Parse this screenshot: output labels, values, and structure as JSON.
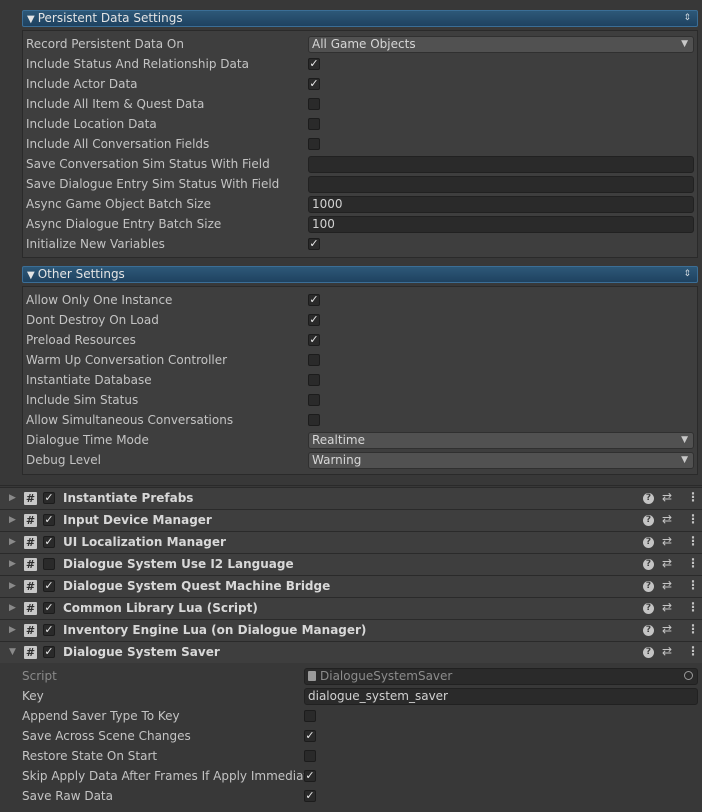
{
  "persistent": {
    "title": "Persistent Data Settings",
    "record_label": "Record Persistent Data On",
    "record_value": "All Game Objects",
    "status_label": "Include Status And Relationship Data",
    "status_checked": true,
    "actor_label": "Include Actor Data",
    "actor_checked": true,
    "items_label": "Include All Item & Quest Data",
    "items_checked": false,
    "location_label": "Include Location Data",
    "location_checked": false,
    "convfields_label": "Include All Conversation Fields",
    "convfields_checked": false,
    "conv_sim_label": "Save Conversation Sim Status With Field",
    "conv_sim_value": "",
    "entry_sim_label": "Save Dialogue Entry Sim Status With Field",
    "entry_sim_value": "",
    "async_go_label": "Async Game Object Batch Size",
    "async_go_value": "1000",
    "async_entry_label": "Async Dialogue Entry Batch Size",
    "async_entry_value": "100",
    "init_vars_label": "Initialize New Variables",
    "init_vars_checked": true
  },
  "other": {
    "title": "Other Settings",
    "one_instance_label": "Allow Only One Instance",
    "one_instance_checked": true,
    "dont_destroy_label": "Dont Destroy On Load",
    "dont_destroy_checked": true,
    "preload_label": "Preload Resources",
    "preload_checked": true,
    "warmup_label": "Warm Up Conversation Controller",
    "warmup_checked": false,
    "instantiate_db_label": "Instantiate Database",
    "instantiate_db_checked": false,
    "sim_status_label": "Include Sim Status",
    "sim_status_checked": false,
    "simultaneous_label": "Allow Simultaneous Conversations",
    "simultaneous_checked": false,
    "time_mode_label": "Dialogue Time Mode",
    "time_mode_value": "Realtime",
    "debug_label": "Debug Level",
    "debug_value": "Warning"
  },
  "components": [
    {
      "name": "Instantiate Prefabs",
      "enabled": true
    },
    {
      "name": "Input Device Manager",
      "enabled": true
    },
    {
      "name": "UI Localization Manager",
      "enabled": true
    },
    {
      "name": "Dialogue System Use I2 Language",
      "enabled": false
    },
    {
      "name": "Dialogue System Quest Machine Bridge",
      "enabled": true
    },
    {
      "name": "Common Library Lua (Script)",
      "enabled": true
    },
    {
      "name": "Inventory Engine Lua (on Dialogue Manager)",
      "enabled": true
    },
    {
      "name": "Dialogue System Saver",
      "enabled": true
    }
  ],
  "saver": {
    "script_label": "Script",
    "script_value": "DialogueSystemSaver",
    "key_label": "Key",
    "key_value": "dialogue_system_saver",
    "append_label": "Append Saver Type To Key",
    "append_checked": false,
    "across_label": "Save Across Scene Changes",
    "across_checked": true,
    "restore_label": "Restore State On Start",
    "restore_checked": false,
    "skip_label": "Skip Apply Data After Frames If Apply Immediate",
    "skip_checked": true,
    "raw_label": "Save Raw Data",
    "raw_checked": true
  },
  "icons": {
    "foldout_open": "▼",
    "foldout_closed": "▶",
    "dropdown_arrow": "▼",
    "checkmark": "✓",
    "script": "#",
    "help": "?",
    "presets": "⇄",
    "more": "⋮",
    "section_menu": "⇕"
  }
}
